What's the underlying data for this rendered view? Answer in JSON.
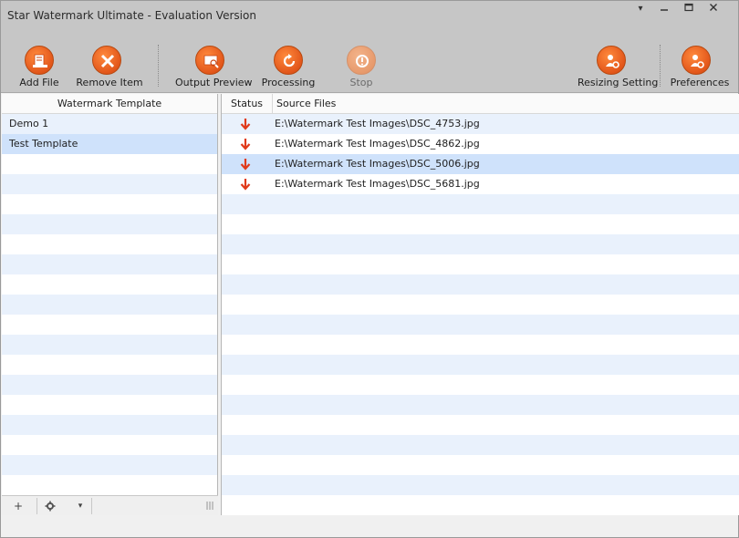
{
  "window": {
    "title": "Star Watermark Ultimate - Evaluation Version",
    "controls": [
      "menu-arrow",
      "minimize",
      "maximize",
      "close"
    ]
  },
  "toolbar": {
    "add_file": "Add File",
    "remove_item": "Remove Item",
    "output_preview": "Output Preview",
    "processing": "Processing",
    "stop": "Stop",
    "resizing_setting": "Resizing Setting",
    "preferences": "Preferences"
  },
  "templates": {
    "header": "Watermark Template",
    "items": [
      {
        "label": "Demo 1",
        "selected": false
      },
      {
        "label": "Test Template",
        "selected": true
      }
    ],
    "footer": {
      "add": "+",
      "settings_icon": "gear-icon",
      "dropdown": "▾"
    }
  },
  "files": {
    "columns": {
      "status": "Status",
      "source": "Source Files"
    },
    "rows": [
      {
        "status": "pending-down-arrow",
        "path": "E:\\Watermark Test Images\\DSC_4753.jpg",
        "selected": false
      },
      {
        "status": "pending-down-arrow",
        "path": "E:\\Watermark Test Images\\DSC_4862.jpg",
        "selected": false
      },
      {
        "status": "pending-down-arrow",
        "path": "E:\\Watermark Test Images\\DSC_5006.jpg",
        "selected": true
      },
      {
        "status": "pending-down-arrow",
        "path": "E:\\Watermark Test Images\\DSC_5681.jpg",
        "selected": false
      }
    ]
  },
  "colors": {
    "accent_orange": "#e2561a",
    "selection": "#cfe2fb",
    "alt_row": "#e9f1fc",
    "status_arrow": "#e03a1a"
  }
}
